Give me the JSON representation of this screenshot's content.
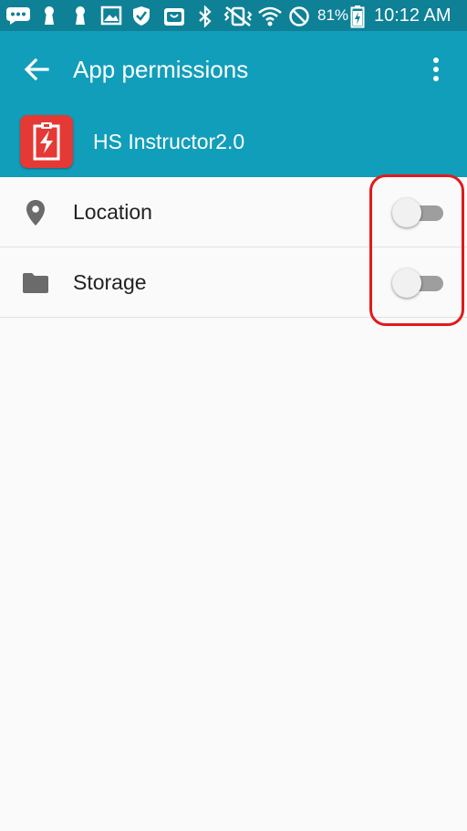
{
  "status_bar": {
    "battery_percent": "81%",
    "time": "10:12 AM",
    "icons": [
      "messages-icon",
      "keyhole-icon",
      "keyhole-icon",
      "gallery-icon",
      "shield-icon",
      "store-icon",
      "bluetooth-icon",
      "vibrate-icon",
      "wifi-icon",
      "do-not-disturb-icon",
      "battery-charging-icon"
    ]
  },
  "app_bar": {
    "title": "App permissions",
    "back_icon": "arrow-back-icon",
    "overflow_icon": "more-vert-icon",
    "color": "#119ebb",
    "status_color": "#0e8197"
  },
  "app": {
    "name": "HS Instructor2.0",
    "icon_color": "#e53935"
  },
  "permissions": [
    {
      "label": "Location",
      "icon": "location-pin-icon",
      "enabled": false
    },
    {
      "label": "Storage",
      "icon": "folder-icon",
      "enabled": false
    }
  ],
  "annotation": {
    "color": "#e01b1b"
  }
}
